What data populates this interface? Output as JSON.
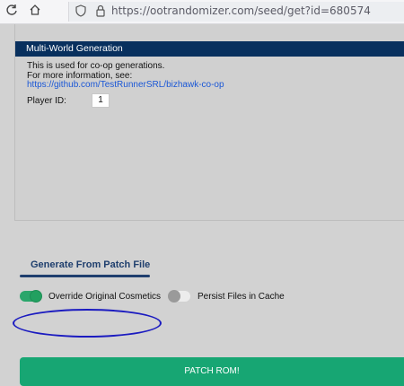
{
  "browser": {
    "back_icon": "refresh-icon",
    "home_icon": "home-icon",
    "url": "https://ootrandomizer.com/seed/get?id=680574"
  },
  "multiworld": {
    "title": "Multi-World Generation",
    "desc_line1": "This is used for co-op generations.",
    "desc_line2": "For more information, see:",
    "link": "https://github.com/TestRunnerSRL/bizhawk-co-op",
    "player_label": "Player ID:",
    "player_value": "1"
  },
  "section_tab": "Generate From Patch File",
  "toggles": {
    "override_label": "Override Original Cosmetics",
    "override_on": true,
    "persist_label": "Persist Files in Cache",
    "persist_on": false
  },
  "patch_button": "PATCH ROM!",
  "colors": {
    "header_bg": "#08305e",
    "accent_green": "#17a673",
    "link_blue": "#1a57d6",
    "annotation_blue": "#1b1bc0"
  }
}
